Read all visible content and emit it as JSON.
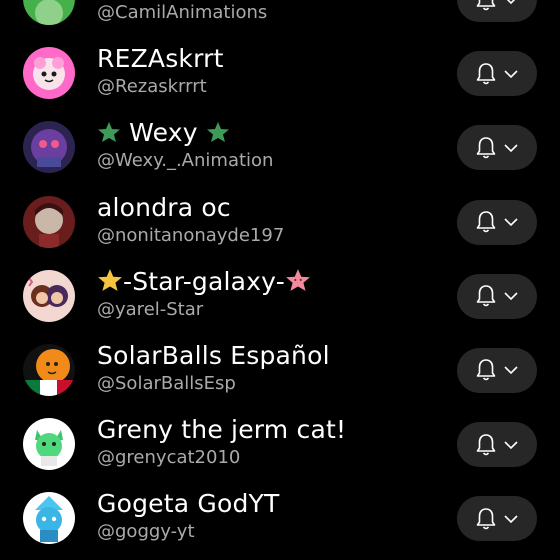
{
  "channels": [
    {
      "name": "",
      "handle": "@CamilAnimations",
      "avatar": "camil-avatar-icon"
    },
    {
      "name": "REZAskrrt",
      "handle": "@Rezaskrrrt",
      "avatar": "rezaskrrt-avatar-icon"
    },
    {
      "name": "🟢 Wexy 🟢",
      "name_parts": {
        "main": "Wexy"
      },
      "handle": "@Wexy._.Animation",
      "avatar": "wexy-avatar-icon"
    },
    {
      "name": "alondra oc",
      "handle": "@nonitanonayde197",
      "avatar": "alondra-avatar-icon"
    },
    {
      "name": "-Star-galaxy-",
      "handle": "@yarel-Star",
      "avatar": "star-galaxy-avatar-icon"
    },
    {
      "name": "SolarBalls Español",
      "handle": "@SolarBallsEsp",
      "avatar": "solarballs-avatar-icon"
    },
    {
      "name": "Greny the jerm cat!",
      "handle": "@grenycat2010",
      "avatar": "greny-avatar-icon"
    },
    {
      "name": "Gogeta GodYT",
      "handle": "@goggy-yt",
      "avatar": "gogeta-avatar-icon"
    }
  ],
  "colors": {
    "background": "#000000",
    "button": "#272727",
    "handle": "#aaaaaa",
    "star_green": "#3d9a57",
    "star_yellow": "#f5c542",
    "star_pink": "#f08a9c"
  },
  "icons": {
    "bell": "bell-icon",
    "chevron": "chevron-down-icon"
  }
}
